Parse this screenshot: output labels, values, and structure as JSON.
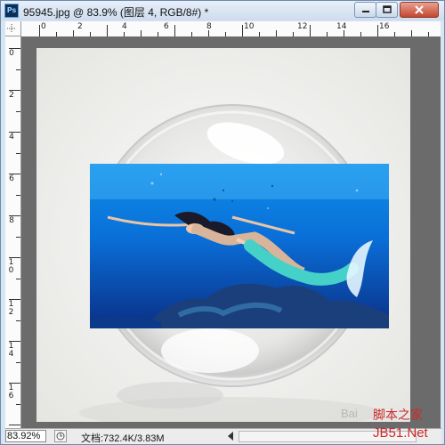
{
  "window": {
    "title": "95945.jpg @ 83.9% (图层 4, RGB/8#) *",
    "app_icon_text": "Ps"
  },
  "rulers": {
    "top_labels": [
      "0",
      "2",
      "4",
      "6",
      "8",
      "10",
      "12",
      "14",
      "16"
    ],
    "left_labels": [
      "0",
      "2",
      "4",
      "6",
      "8",
      "10",
      "12",
      "14",
      "16"
    ]
  },
  "status": {
    "zoom": "83.92%",
    "doc_info": "文档:732.4K/3.83M"
  },
  "watermark": {
    "line1": "脚本之家",
    "line2": "JB51.Net",
    "baidu_text": "Bai"
  },
  "colors": {
    "titlebar": "#d7e4f2",
    "canvas_bg": "#6b6b6b",
    "water_top": "#0e8fe8",
    "water_bottom": "#0a2f86"
  }
}
